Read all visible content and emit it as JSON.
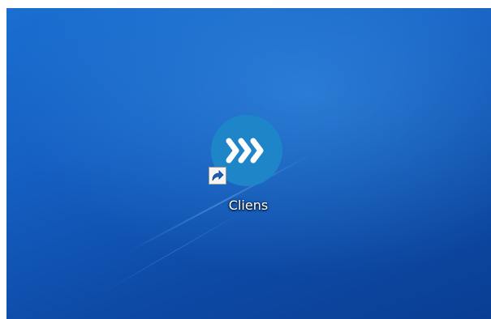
{
  "desktop": {
    "background_colors": {
      "top": "#1a6fd0",
      "bottom": "#0a3e93"
    },
    "icons": [
      {
        "label": "Cliens",
        "icon": "cliens-chevrons-icon",
        "icon_color": "#1e86c8",
        "is_shortcut": true,
        "overlay_icon": "shortcut-arrow-icon"
      }
    ]
  }
}
